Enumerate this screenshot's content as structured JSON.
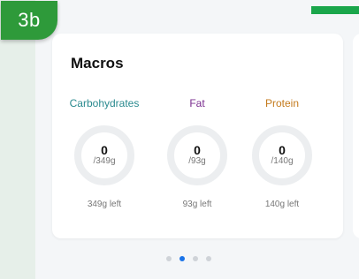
{
  "badge": {
    "label": "3b"
  },
  "card": {
    "title": "Macros",
    "macros": [
      {
        "name": "Carbohydrates",
        "color": "#2a8a8f",
        "value": "0",
        "goal": "/349g",
        "left": "349g left"
      },
      {
        "name": "Fat",
        "color": "#7a2d8f",
        "value": "0",
        "goal": "/93g",
        "left": "93g left"
      },
      {
        "name": "Protein",
        "color": "#c47a1c",
        "value": "0",
        "goal": "/140g",
        "left": "140g left"
      }
    ]
  },
  "pager": {
    "count": 4,
    "active_index": 1
  },
  "colors": {
    "badge": "#2e9a3a",
    "accent_bar": "#1aa64b",
    "active_dot": "#1a73e8",
    "inactive_dot": "#cfd3d8",
    "ring_track": "#eceef0"
  }
}
